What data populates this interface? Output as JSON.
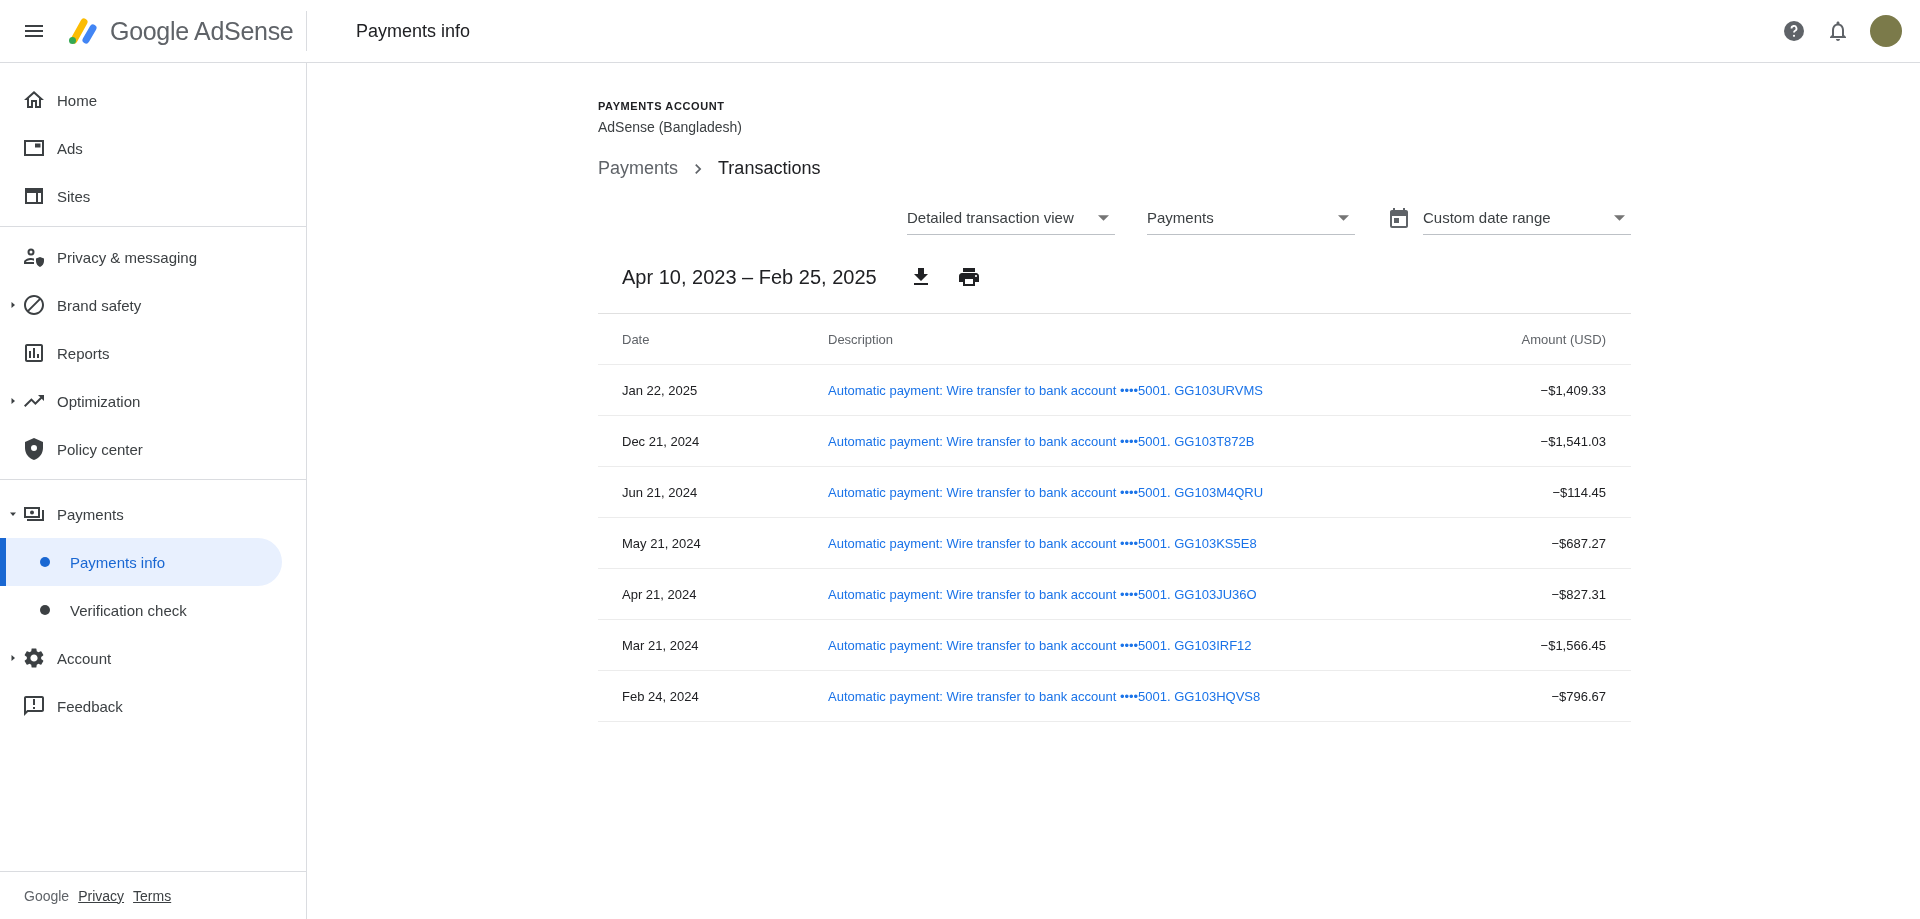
{
  "header": {
    "logo_text": "Google AdSense",
    "page_title": "Payments info"
  },
  "sidebar": {
    "sections": [
      {
        "items": [
          {
            "label": "Home",
            "selected": false
          },
          {
            "label": "Ads",
            "selected": false
          },
          {
            "label": "Sites",
            "selected": false
          }
        ]
      },
      {
        "items": [
          {
            "label": "Privacy & messaging",
            "selected": false
          },
          {
            "label": "Brand safety",
            "selected": false,
            "expanded": false
          },
          {
            "label": "Reports",
            "selected": false
          },
          {
            "label": "Optimization",
            "selected": false,
            "expanded": false
          },
          {
            "label": "Policy center",
            "selected": false
          }
        ]
      },
      {
        "items": [
          {
            "label": "Payments",
            "selected": false,
            "expanded": true,
            "children": [
              {
                "label": "Payments info",
                "selected": true
              },
              {
                "label": "Verification check",
                "selected": false
              }
            ]
          },
          {
            "label": "Account",
            "selected": false,
            "expanded": false
          },
          {
            "label": "Feedback",
            "selected": false
          }
        ]
      }
    ],
    "footer": {
      "brand": "Google",
      "links": [
        "Privacy",
        "Terms"
      ]
    }
  },
  "account": {
    "label": "PAYMENTS ACCOUNT",
    "name": "AdSense (Bangladesh)"
  },
  "breadcrumbs": [
    {
      "label": "Payments",
      "selected": false
    },
    {
      "label": "Transactions",
      "selected": true
    }
  ],
  "filters": [
    {
      "kind": "select",
      "value": "Detailed transaction view"
    },
    {
      "kind": "select",
      "value": "Payments"
    },
    {
      "kind": "date",
      "value": "Custom date range"
    }
  ],
  "range": "Apr 10, 2023 – Feb 25, 2025",
  "table": {
    "columns": [
      "Date",
      "Description",
      "Amount (USD)"
    ],
    "rows": [
      {
        "date": "Jan 22, 2025",
        "description": "Automatic payment: Wire transfer to bank account ••••5001. GG103URVMS",
        "amount": "−$1,409.33"
      },
      {
        "date": "Dec 21, 2024",
        "description": "Automatic payment: Wire transfer to bank account ••••5001. GG103T872B",
        "amount": "−$1,541.03"
      },
      {
        "date": "Jun 21, 2024",
        "description": "Automatic payment: Wire transfer to bank account ••••5001. GG103M4QRU",
        "amount": "−$114.45"
      },
      {
        "date": "May 21, 2024",
        "description": "Automatic payment: Wire transfer to bank account ••••5001. GG103KS5E8",
        "amount": "−$687.27"
      },
      {
        "date": "Apr 21, 2024",
        "description": "Automatic payment: Wire transfer to bank account ••••5001. GG103JU36O",
        "amount": "−$827.31"
      },
      {
        "date": "Mar 21, 2024",
        "description": "Automatic payment: Wire transfer to bank account ••••5001. GG103IRF12",
        "amount": "−$1,566.45"
      },
      {
        "date": "Feb 24, 2024",
        "description": "Automatic payment: Wire transfer to bank account ••••5001. GG103HQVS8",
        "amount": "−$796.67"
      }
    ]
  }
}
